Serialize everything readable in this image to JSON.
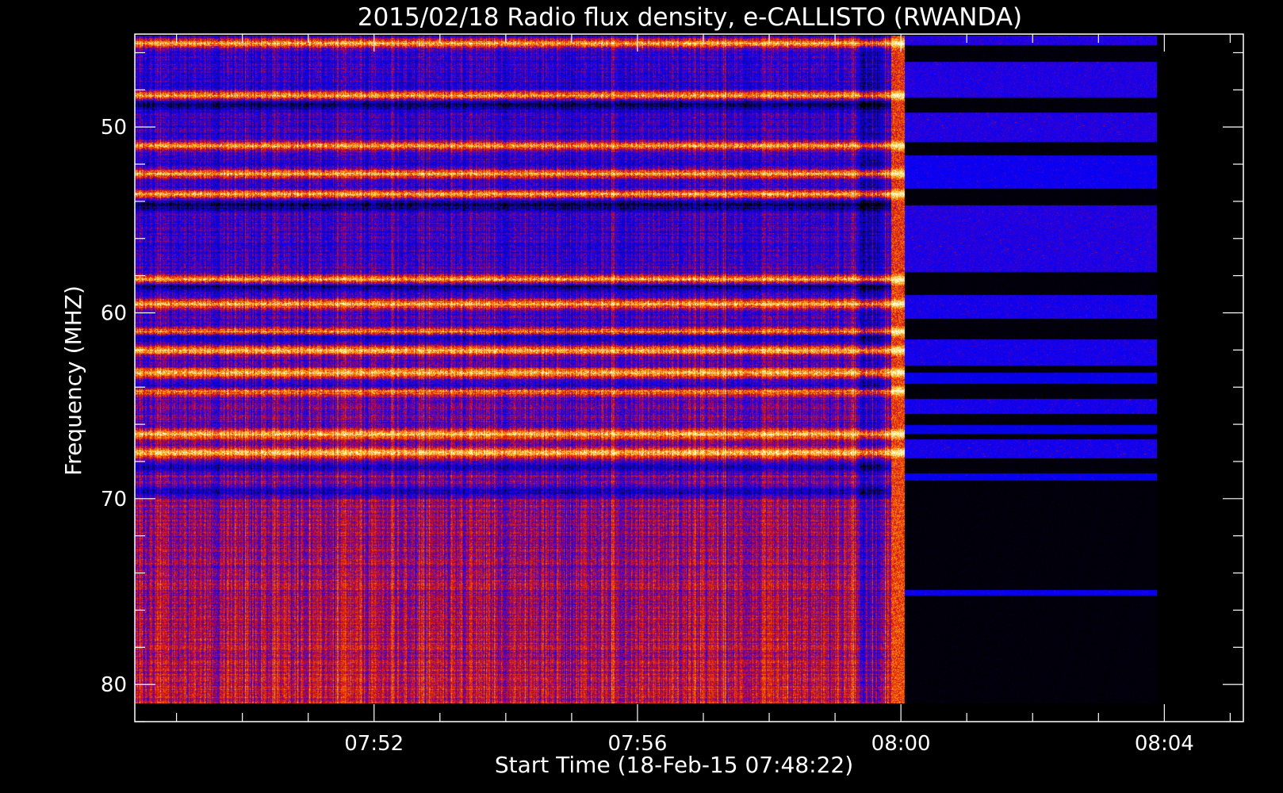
{
  "chart_data": {
    "type": "heatmap",
    "title": "2015/02/18  Radio flux density, e-CALLISTO (RWANDA)",
    "xlabel": "Start Time (18-Feb-15 07:48:22)",
    "ylabel": "Frequency (MHZ)",
    "x_axis": {
      "unit": "time",
      "range": [
        "07:48:22",
        "08:05:12"
      ],
      "ticks": [
        "07:52",
        "07:56",
        "08:00",
        "08:04"
      ],
      "data_start": "07:48:22",
      "data_end": "08:03:53",
      "gap_onset": "07:59:51"
    },
    "y_axis": {
      "unit": "MHz",
      "range": [
        45,
        82
      ],
      "reversed": true,
      "ticks": [
        50,
        60,
        70,
        80
      ],
      "data_range": [
        45.1,
        81.0
      ]
    },
    "colormap": [
      "#000000",
      "#1a00a0",
      "#0000ff",
      "#8a0080",
      "#e02000",
      "#ff7000",
      "#ffd040",
      "#ffffe0"
    ],
    "grid": false,
    "legend": "none",
    "bright_bands_mhz": [
      45.5,
      48.3,
      51.0,
      52.5,
      53.6,
      58.2,
      59.5,
      61.0,
      62.0,
      63.2,
      64.2,
      66.5,
      67.5
    ],
    "rfi_dropout_bands_mhz": [
      48.8,
      54.2,
      58.6,
      61.2,
      64.0,
      68.3,
      69.6
    ]
  }
}
